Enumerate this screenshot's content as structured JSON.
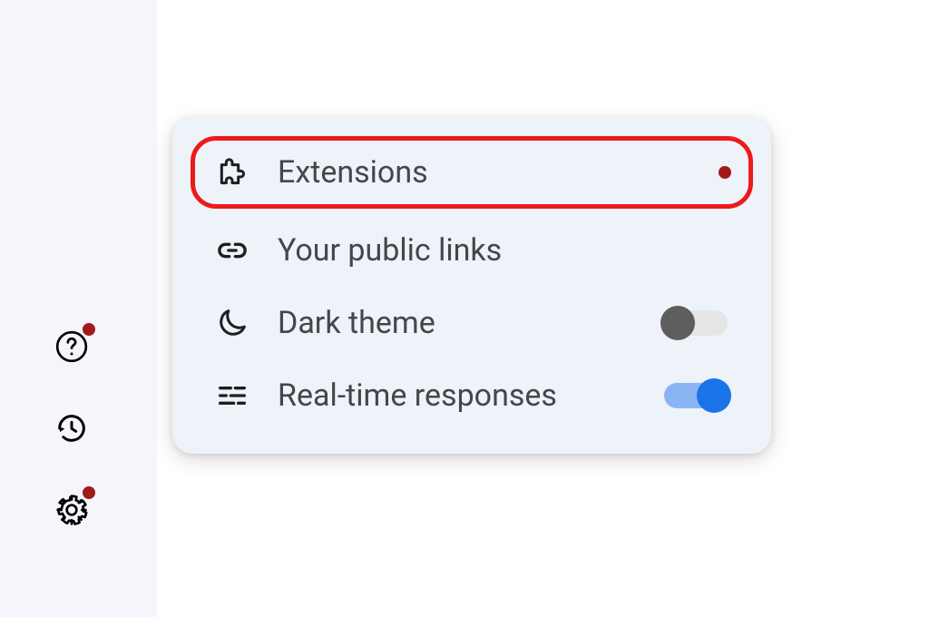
{
  "menu": {
    "items": [
      {
        "label": "Extensions",
        "has_dot": true,
        "highlighted": true
      },
      {
        "label": "Your public links"
      },
      {
        "label": "Dark theme",
        "toggle": "off"
      },
      {
        "label": "Real-time responses",
        "toggle": "on"
      }
    ]
  },
  "colors": {
    "highlight_border": "#ec1a1a",
    "panel_bg": "#eef2f9",
    "toggle_on": "#1a73e8",
    "toggle_on_track": "#8ab4f4",
    "notification_dot": "#a11b1b"
  }
}
